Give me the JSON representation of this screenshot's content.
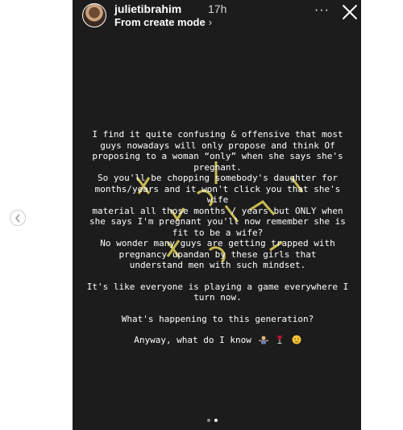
{
  "header": {
    "username": "julietibrahim",
    "time": "17h",
    "subtitle": "From create mode",
    "subtitle_chevron": "›",
    "more_label": "···"
  },
  "story": {
    "lines": [
      "I find it quite confusing & offensive that most",
      "guys nowadays will only propose and think Of",
      "proposing to a woman “only” when she says she's",
      "pregnant.",
      "So you'll be chopping somebody's daughter for",
      "months/years and it won't click you that she's wife",
      "material all those months / years but ONLY when",
      "she says I'm pregnant you'll now remember she is",
      "fit to be a wife?",
      "No wonder many guys are getting trapped with",
      "pregnancy upandan by these girls that",
      "understand men with such mindset.",
      "",
      "It's like everyone is playing a game everywhere I",
      "turn now.",
      "",
      "What's happening to this generation?",
      "",
      "Anyway, what do I know"
    ],
    "emojis": [
      "person-shrugging-emoji",
      "wine-glass-emoji",
      "face-emoji"
    ]
  },
  "colors": {
    "story_background": "#1c1c1c",
    "text": "#ffffff",
    "watermark": "#e6d65a"
  }
}
